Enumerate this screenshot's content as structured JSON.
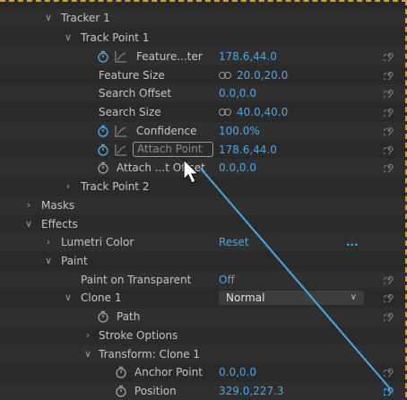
{
  "rows": {
    "tracker1": "Tracker 1",
    "trackpoint1": "Track Point 1",
    "feature_center": {
      "label": "Feature...ter",
      "value": "178.6,44.0"
    },
    "feature_size": {
      "label": "Feature Size",
      "value": "20.0,20.0"
    },
    "search_offset": {
      "label": "Search Offset",
      "value": "0.0,0.0"
    },
    "search_size": {
      "label": "Search Size",
      "value": "40.0,40.0"
    },
    "confidence": {
      "label": "Confidence",
      "value": "100.0%"
    },
    "attach_point": {
      "label": "Attach Point",
      "value": "178.6,44.0"
    },
    "attach_offset": {
      "label": "Attach ...t Offset",
      "value": "0.0,0.0"
    },
    "trackpoint2": "Track Point 2",
    "masks": "Masks",
    "effects": "Effects",
    "lumetri": {
      "label": "Lumetri Color",
      "value": "Reset",
      "extra": "..."
    },
    "paint": "Paint",
    "paint_transparent": {
      "label": "Paint on Transparent",
      "value": "Off"
    },
    "clone1": {
      "label": "Clone 1",
      "mode": "Normal"
    },
    "path": "Path",
    "stroke_options": "Stroke Options",
    "transform_clone1": "Transform: Clone 1",
    "anchor_point": {
      "label": "Anchor Point",
      "value": "0.0,0.0"
    },
    "position": {
      "label": "Position",
      "value": "329.0,227.3"
    }
  },
  "colors": {
    "value_blue": "#4aa8e6",
    "frame_dash": "#c9a13a",
    "panel_bg": "#2a2a2a",
    "pickwhip_line": "#4aa8e6"
  },
  "icons": {
    "stopwatch": "stopwatch-icon",
    "graph": "graph-icon",
    "pickwhip": "pickwhip-icon",
    "link": "link-icon",
    "cursor": "arrow-cursor-icon"
  }
}
